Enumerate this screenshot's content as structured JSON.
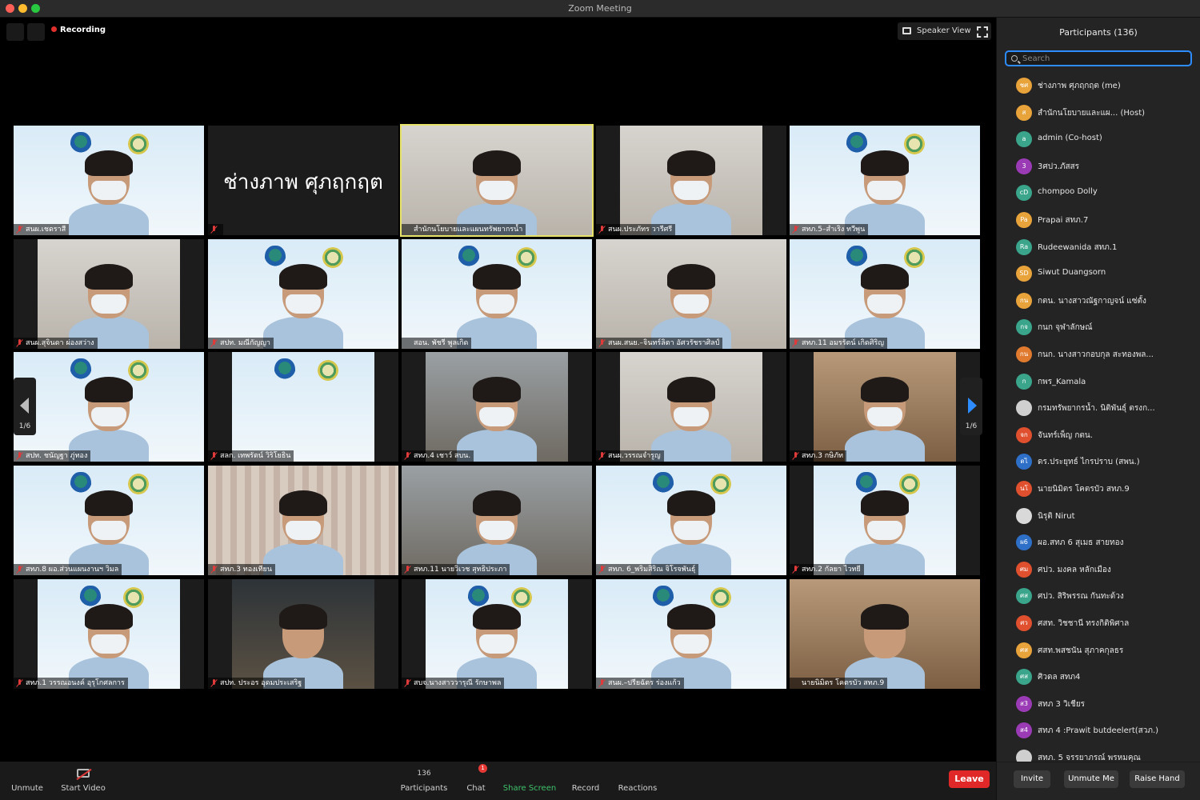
{
  "window": {
    "title": "Zoom Meeting"
  },
  "top": {
    "recording_label": "Recording",
    "speaker_view_label": "Speaker View"
  },
  "tiles": [
    {
      "name": "สนผ.เชดราสี",
      "bg": "blue",
      "muted": true
    },
    {
      "name": "",
      "big": "ช่างภาพ  ศุภฤกฤต",
      "muted": true
    },
    {
      "name": "สำนักนโยบายและแผนทรัพยากรน้ำ",
      "bg": "office",
      "muted": false,
      "active": true
    },
    {
      "name": "สนผ.ประภัทร วารีศรี",
      "bg": "office",
      "muted": true
    },
    {
      "name": "สทภ.5–สำเริง ทวีพูน",
      "bg": "blue",
      "muted": true
    },
    {
      "name": "สนผ.สุจินดา ผ่องสว่าง",
      "bg": "office",
      "muted": true
    },
    {
      "name": "สปท. มณีกัญญา",
      "bg": "blue",
      "muted": true
    },
    {
      "name": "สอน. พัชรี พูลเกิด",
      "bg": "blue",
      "muted": false
    },
    {
      "name": "สนผ.สนย.–จินทร์ลิตา อัศวรัชราศิลป์",
      "bg": "office",
      "muted": true
    },
    {
      "name": "สทภ.11 อมรรัตน์ เกิดศิริญ",
      "bg": "blue",
      "muted": true
    },
    {
      "name": "สปท. ชนัญฐา ภู่ทอง",
      "bg": "blue",
      "muted": true
    },
    {
      "name": "สลก. เทพรัตน์ วิริโยธิน",
      "bg": "blue",
      "muted": true
    },
    {
      "name": "สทภ.4 เชาว์ สบน.",
      "bg": "room",
      "muted": true
    },
    {
      "name": "สนผ.วรรณจำรูญ",
      "bg": "office",
      "muted": true
    },
    {
      "name": "สทภ.3 กษิภัท",
      "bg": "warm",
      "muted": true
    },
    {
      "name": "สทภ.8 ผอ.ส่วนแผนงานฯ วิมล",
      "bg": "blue",
      "muted": true
    },
    {
      "name": "สทภ.3 ทองเทียน",
      "bg": "curtain",
      "muted": true
    },
    {
      "name": "สทภ.11 นายวิเวช สุทธิประภา",
      "bg": "room",
      "muted": true
    },
    {
      "name": "สทภ. 6_พริมสิริณ จิโรจพันธุ์",
      "bg": "blue",
      "muted": true
    },
    {
      "name": "สทภ.2 กัลยา ไวทยี",
      "bg": "blue",
      "muted": true
    },
    {
      "name": "สทภ.1 วรรณอนงค์ อุรุโกศลการ",
      "bg": "blue",
      "muted": true
    },
    {
      "name": "สปท. ประอร อุดมประเสริฐ",
      "bg": "dark",
      "muted": true
    },
    {
      "name": "สบจ.นางสาววารุณี รักษาพล",
      "bg": "blue",
      "muted": true
    },
    {
      "name": "สนผ.–ปรียฉัตร ร่องแก้ว",
      "bg": "blue",
      "muted": true
    },
    {
      "name": "นายนิมิตร โคตรบัว สทภ.9",
      "bg": "warm",
      "muted": false
    }
  ],
  "pager": {
    "left_label": "1/6",
    "right_label": "1/6"
  },
  "sidebar": {
    "title": "Participants (136)",
    "search_placeholder": "Search",
    "participants": [
      {
        "initials": "ชศ",
        "name": "ช่างภาพ  ศุภฤกฤต (me)",
        "color": "#e8a33b"
      },
      {
        "initials": "ส",
        "name": "สำนักนโยบายและแผ... (Host)",
        "color": "#e8a33b"
      },
      {
        "initials": "a",
        "name": "admin (Co-host)",
        "color": "#3aa58b"
      },
      {
        "initials": "3",
        "name": "3ศปว.ภัสสร",
        "color": "#9a3bb5"
      },
      {
        "initials": "cD",
        "name": "chompoo Dolly",
        "color": "#3aa58b"
      },
      {
        "initials": "Pa",
        "name": "Prapai สทภ.7",
        "color": "#e8a33b"
      },
      {
        "initials": "Ra",
        "name": "Rudeewanida สทภ.1",
        "color": "#3aa58b"
      },
      {
        "initials": "SD",
        "name": "Siwut Duangsorn",
        "color": "#e8a33b"
      },
      {
        "initials": "กน",
        "name": "กตน. นางสาวณัฐกาญจน์ แซ่ตั้ง",
        "color": "#e8a33b"
      },
      {
        "initials": "กจ",
        "name": "กนก จุฬาลักษณ์",
        "color": "#3aa58b"
      },
      {
        "initials": "กน",
        "name": "กนก. นางสาวกอบกุล สะทองพล...",
        "color": "#e07a2e"
      },
      {
        "initials": "ก",
        "name": "กพร_Kamala",
        "color": "#3aa58b"
      },
      {
        "initials": "",
        "name": "กรมทรัพยากรน้ำ. นิติพันธุ์ ตรงก...",
        "color": "#cfcfcf"
      },
      {
        "initials": "จก",
        "name": "จันทร์เพ็ญ กตน.",
        "color": "#e0502e"
      },
      {
        "initials": "ดไ",
        "name": "ดร.ประยุทธ์ ไกรปราบ (สพน.)",
        "color": "#2e6fc8"
      },
      {
        "initials": "นโ",
        "name": "นายนิมิตร โคตรบัว สทภ.9",
        "color": "#e0502e"
      },
      {
        "initials": "",
        "name": "นิรุติ Nirut",
        "color": "#d9d9d9"
      },
      {
        "initials": "ผ6",
        "name": "ผอ.สทภ 6 สุเมธ สายทอง",
        "color": "#2e6fc8"
      },
      {
        "initials": "ศม",
        "name": "ศปว. มงคล หลักเมือง",
        "color": "#e0502e"
      },
      {
        "initials": "ศส",
        "name": "ศปว. สิริพรรณ กันทะด้วง",
        "color": "#3aa58b"
      },
      {
        "initials": "ศว",
        "name": "ศสท. วิชชานี ทรงกิติพิศาล",
        "color": "#e0502e"
      },
      {
        "initials": "ศส",
        "name": "ศสท.พสชนัน สุภาคกุลธร",
        "color": "#e8a33b"
      },
      {
        "initials": "ศส",
        "name": "ศิวดล สทภ4",
        "color": "#3aa58b"
      },
      {
        "initials": "ส3",
        "name": "สทภ 3 วิเชียร",
        "color": "#9a3bb5"
      },
      {
        "initials": "ส4",
        "name": "สทภ 4 :Prawit butdeelert(สวภ.)",
        "color": "#9a3bb5"
      },
      {
        "initials": "",
        "name": "สทภ. 5 จรรยาภรณ์ พรหมคุณ",
        "color": "#cfcfcf"
      }
    ],
    "invite_label": "Invite",
    "unmute_me_label": "Unmute Me",
    "raise_hand_label": "Raise Hand"
  },
  "toolbar": {
    "unmute_label": "Unmute",
    "start_video_label": "Start Video",
    "participants_count": "136",
    "participants_label": "Participants",
    "chat_label": "Chat",
    "chat_badge": "1",
    "share_label": "Share Screen",
    "record_label": "Record",
    "reactions_label": "Reactions",
    "leave_label": "Leave"
  }
}
